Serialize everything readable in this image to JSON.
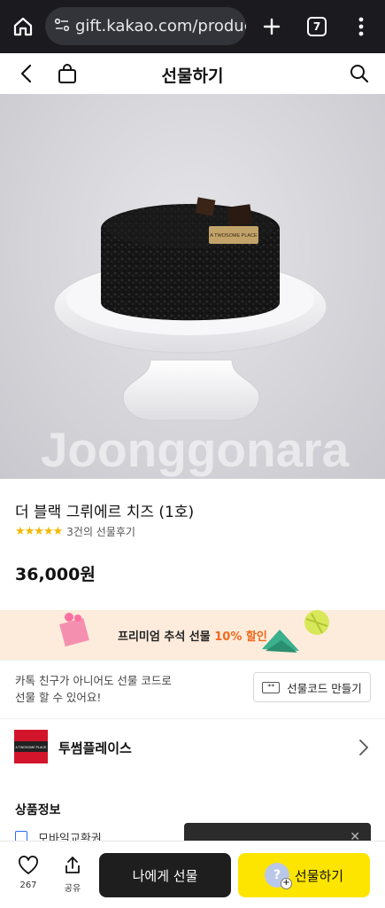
{
  "browser": {
    "url": "gift.kakao.com/product/",
    "tab_count": "7",
    "icons": [
      "home-icon",
      "site-settings-icon",
      "new-tab-icon",
      "tab-switcher-icon",
      "more-vert-icon"
    ]
  },
  "header": {
    "title": "선물하기",
    "icons": [
      "back-icon",
      "shopping-bag-icon",
      "search-icon"
    ]
  },
  "product": {
    "watermark": "Joonggonara",
    "cake_plaque": "A TWOSOME PLACE",
    "name": "더 블랙 그뤼에르 치즈 (1호)",
    "stars": "★★★★★",
    "rating_value": 5,
    "review_text": "3건의 선물후기",
    "price": "36,000원"
  },
  "promo": {
    "text": "프리미엄 추석 선물 ",
    "accent": "10% 할인",
    "accent_color": "#f06a1c"
  },
  "gift_code": {
    "desc_line1": "카톡 친구가 아니어도 선물 코드로",
    "desc_line2": "선물 할 수 있어요!",
    "button_label": "선물코드 만들기",
    "button_icon_text": "**"
  },
  "brand": {
    "name": "투썸플레이스",
    "logo_text": "A TWOSOME PLACE"
  },
  "info": {
    "title": "상품정보",
    "item_label": "모바일교환권",
    "toast_close": "✕"
  },
  "bottom": {
    "like_count": "267",
    "share_label": "공유",
    "self_gift_label": "나에게 선물",
    "gift_label": "선물하기",
    "avatar_text": "?",
    "avatar_plus": "+"
  },
  "colors": {
    "kakao_yellow": "#fee500",
    "browser_bg": "#1b1b1f",
    "star": "#f5b800",
    "brand_red": "#d3152b"
  }
}
